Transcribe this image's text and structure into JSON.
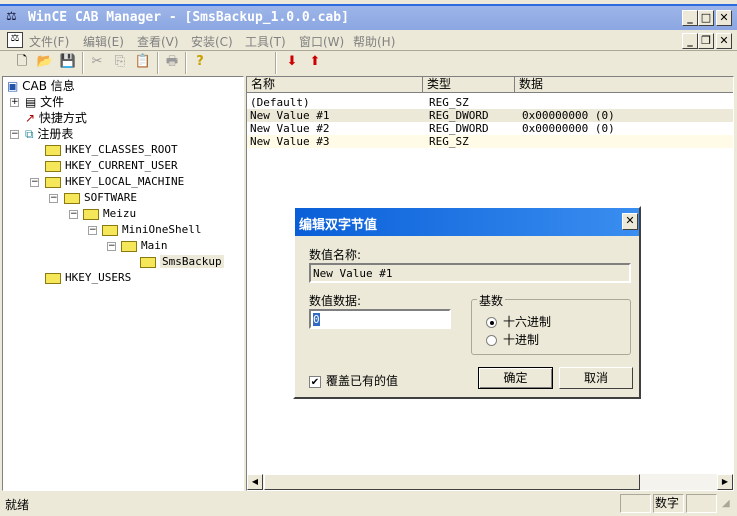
{
  "window": {
    "title": "WinCE CAB Manager - [SmsBackup_1.0.0.cab]"
  },
  "menu": [
    "文件(F)",
    "编辑(E)",
    "查看(V)",
    "安装(C)",
    "工具(T)",
    "窗口(W)",
    "帮助(H)"
  ],
  "tree": {
    "root": "CAB 信息",
    "files": "文件",
    "shortcuts": "快捷方式",
    "registry": "注册表",
    "hkcr": "HKEY_CLASSES_ROOT",
    "hkcu": "HKEY_CURRENT_USER",
    "hklm": "HKEY_LOCAL_MACHINE",
    "software": "SOFTWARE",
    "meizu": "Meizu",
    "minioneshell": "MiniOneShell",
    "main": "Main",
    "smsbackup": "SmsBackup",
    "hku": "HKEY_USERS"
  },
  "list": {
    "columns": [
      "名称",
      "类型",
      "数据"
    ],
    "rows": [
      {
        "name": "(Default)",
        "type": "REG_SZ",
        "data": ""
      },
      {
        "name": "New Value #1",
        "type": "REG_DWORD",
        "data": "0x00000000  (0)"
      },
      {
        "name": "New Value #2",
        "type": "REG_DWORD",
        "data": "0x00000000  (0)"
      },
      {
        "name": "New Value #3",
        "type": "REG_SZ",
        "data": ""
      }
    ]
  },
  "dialog": {
    "title": "编辑双字节值",
    "name_label": "数值名称:",
    "name_value": "New Value #1",
    "data_label": "数值数据:",
    "data_value": "0",
    "base_label": "基数",
    "hex": "十六进制",
    "dec": "十进制",
    "overwrite": "覆盖已有的值",
    "ok": "确定",
    "cancel": "取消"
  },
  "status": {
    "text": "就绪",
    "num": "数字"
  }
}
